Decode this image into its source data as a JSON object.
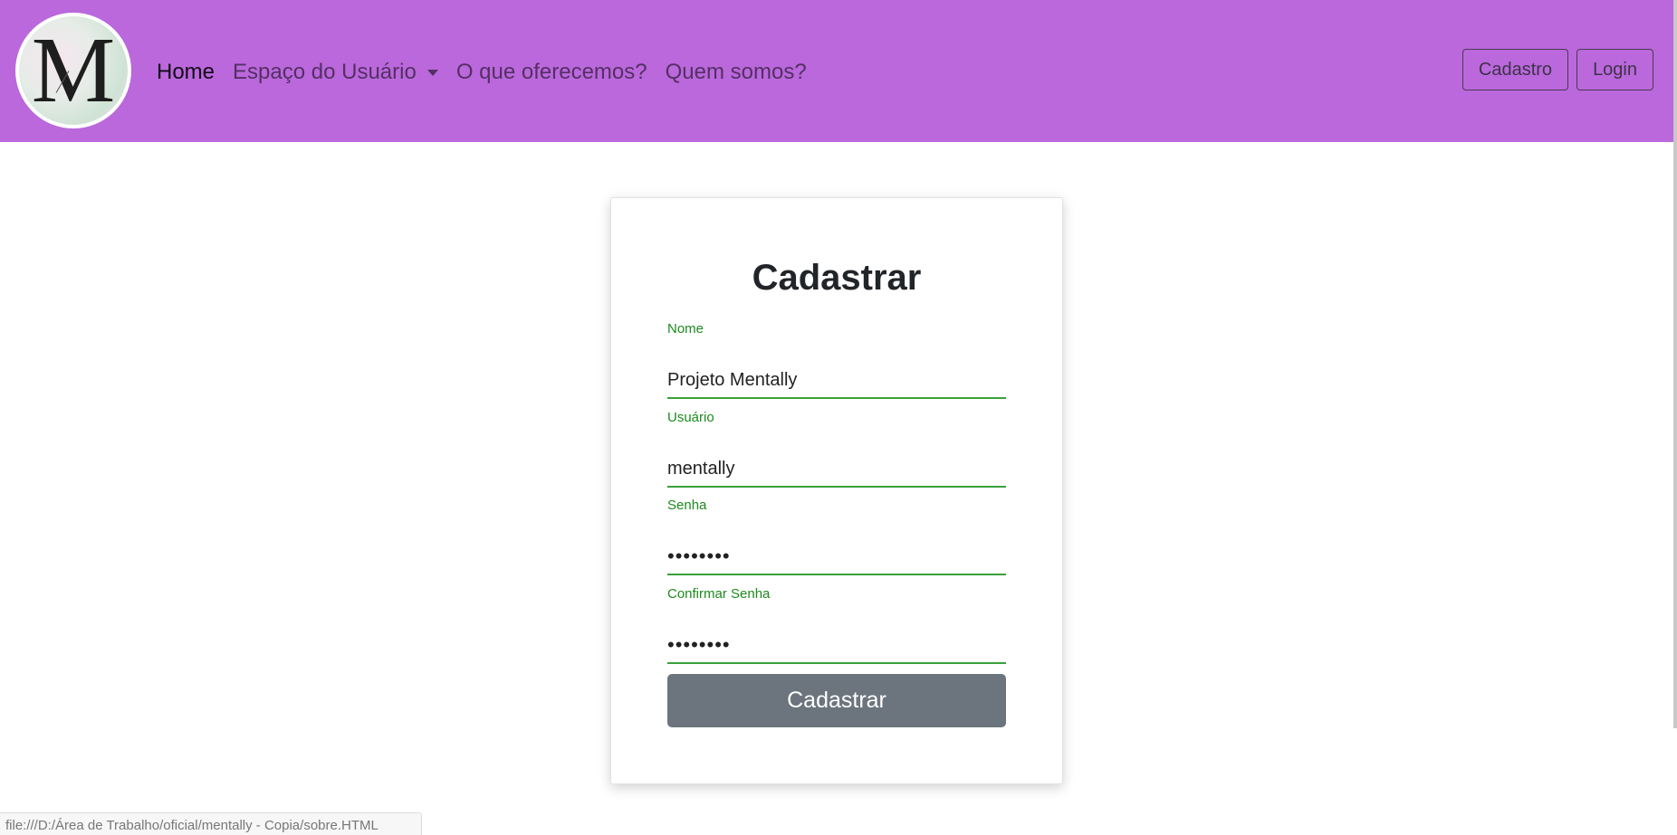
{
  "navbar": {
    "logo_letter": "M",
    "links": [
      "Home",
      "Espaço do Usuário",
      "O que oferecemos?",
      "Quem somos?"
    ],
    "buttons": [
      "Cadastro",
      "Login"
    ]
  },
  "form": {
    "title": "Cadastrar",
    "fields": [
      {
        "label": "Nome",
        "value": "Projeto Mentally"
      },
      {
        "label": "Usuário",
        "value": "mentally"
      },
      {
        "label": "Senha",
        "value": "mentally"
      },
      {
        "label": "Confirmar Senha",
        "value": "mentally"
      }
    ],
    "submit_label": "Cadastrar"
  },
  "status_url": "file:///D:/Área de Trabalho/oficial/mentally - Copia/sobre.HTML",
  "colors": {
    "navbar_bg": "#ba68dc",
    "field_accent": "#1d8a1d",
    "submit_bg": "#6c757d"
  }
}
